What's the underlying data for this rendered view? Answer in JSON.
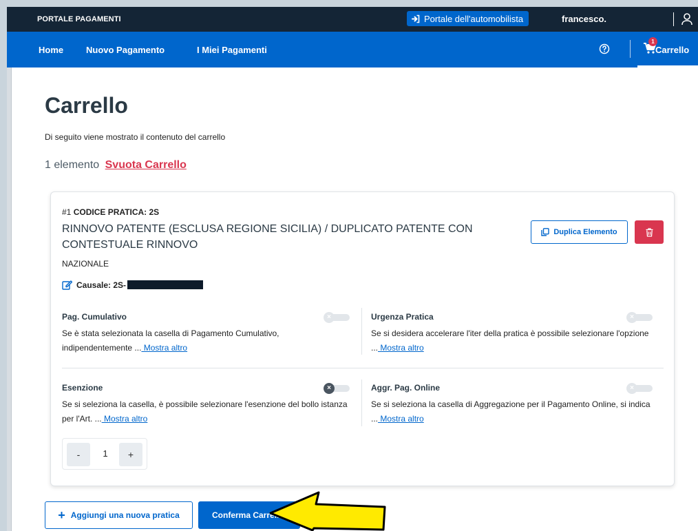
{
  "header": {
    "brand": "PORTALE PAGAMENTI",
    "external_link": "Portale dell'automobilista",
    "user_name": "francesco."
  },
  "nav": {
    "items": [
      {
        "label": "Home"
      },
      {
        "label": "Nuovo Pagamento"
      },
      {
        "label": "I Miei Pagamenti"
      }
    ],
    "cart_label": "Carrello",
    "cart_count": "1"
  },
  "page": {
    "title": "Carrello",
    "subtitle": "Di seguito viene mostrato il contenuto del carrello",
    "item_count": "1 elemento",
    "clear_link": "Svuota Carrello"
  },
  "cart_item": {
    "index": "#1",
    "code_label": "CODICE PRATICA:",
    "code_value": "2S",
    "service_title": "RINNOVO PATENTE (ESCLUSA REGIONE SICILIA) / DUPLICATO PATENTE CON CONTESTUALE RINNOVO",
    "scope": "NAZIONALE",
    "causale_label": "Causale:",
    "causale_value": "2S-",
    "duplicate_label": "Duplica Elemento",
    "options": [
      {
        "title": "Pag. Cumulativo",
        "desc": "Se è stata selezionata la casella di Pagamento Cumulativo, indipendentemente ...",
        "more": " Mostra altro",
        "active": false
      },
      {
        "title": "Urgenza Pratica",
        "desc": "Se si desidera accelerare l'iter della pratica è possibile selezionare l'opzione ...",
        "more": " Mostra altro",
        "active": false
      },
      {
        "title": "Esenzione",
        "desc": "Se si seleziona la casella, è possibile selezionare l'esenzione del bollo istanza per l'Art. ...",
        "more": " Mostra altro",
        "active": true
      },
      {
        "title": "Aggr. Pag. Online",
        "desc": "Se si seleziona la casella di Aggregazione per il Pagamento Online, si indica ...",
        "more": " Mostra altro",
        "active": false
      }
    ],
    "quantity": "1",
    "minus": "-",
    "plus": "+"
  },
  "actions": {
    "add_label": "Aggiungi una nuova pratica",
    "add_icon": "+",
    "confirm_label": "Conferma Carrello"
  },
  "colors": {
    "primary": "#0066cc",
    "header_dark": "#142536",
    "danger": "#d9364f",
    "arrow": "#ffea00"
  }
}
